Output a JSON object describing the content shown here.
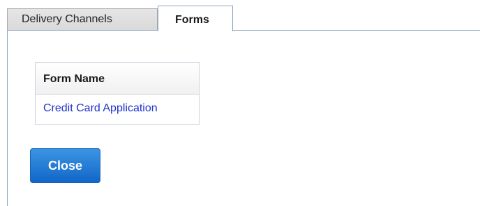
{
  "tabs": [
    {
      "label": "Delivery Channels",
      "active": false
    },
    {
      "label": "Forms",
      "active": true
    }
  ],
  "forms_table": {
    "header": "Form Name",
    "rows": [
      {
        "form_name": "Credit Card Application"
      }
    ]
  },
  "actions": {
    "close_label": "Close"
  },
  "colors": {
    "border": "#8ea4c0",
    "link": "#1f33cc",
    "button": "#1166c7"
  }
}
